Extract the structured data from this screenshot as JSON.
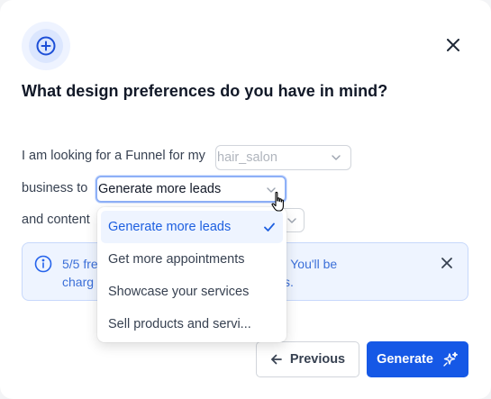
{
  "modal": {
    "header_icon": "plus-circle-icon",
    "close_icon": "close-icon",
    "title": "What design preferences do you have in mind?"
  },
  "form": {
    "line1_text": "I am looking for a Funnel for my",
    "industry_value": "hair_salon",
    "line2_text": "business to",
    "goal_value": "Generate more leads",
    "line3_text": "and content"
  },
  "dropdown": {
    "options": [
      {
        "label": "Generate more leads",
        "selected": true
      },
      {
        "label": "Get more appointments",
        "selected": false
      },
      {
        "label": "Showcase your services",
        "selected": false
      },
      {
        "label": "Sell products and servi...",
        "selected": false
      }
    ]
  },
  "info": {
    "icon": "info-icon",
    "text_line1_prefix": "5/5 fre",
    "text_line1_suffix": ". You'll be",
    "text_line2_prefix": "charg",
    "text_line2_suffix": "s.",
    "close_icon": "close-icon"
  },
  "footer": {
    "previous_label": "Previous",
    "generate_label": "Generate",
    "generate_icon": "sparkles-icon",
    "previous_icon": "arrow-left-icon"
  },
  "colors": {
    "primary": "#1558e6",
    "info_bg": "#eef4ff",
    "info_text": "#3b6fd8"
  }
}
